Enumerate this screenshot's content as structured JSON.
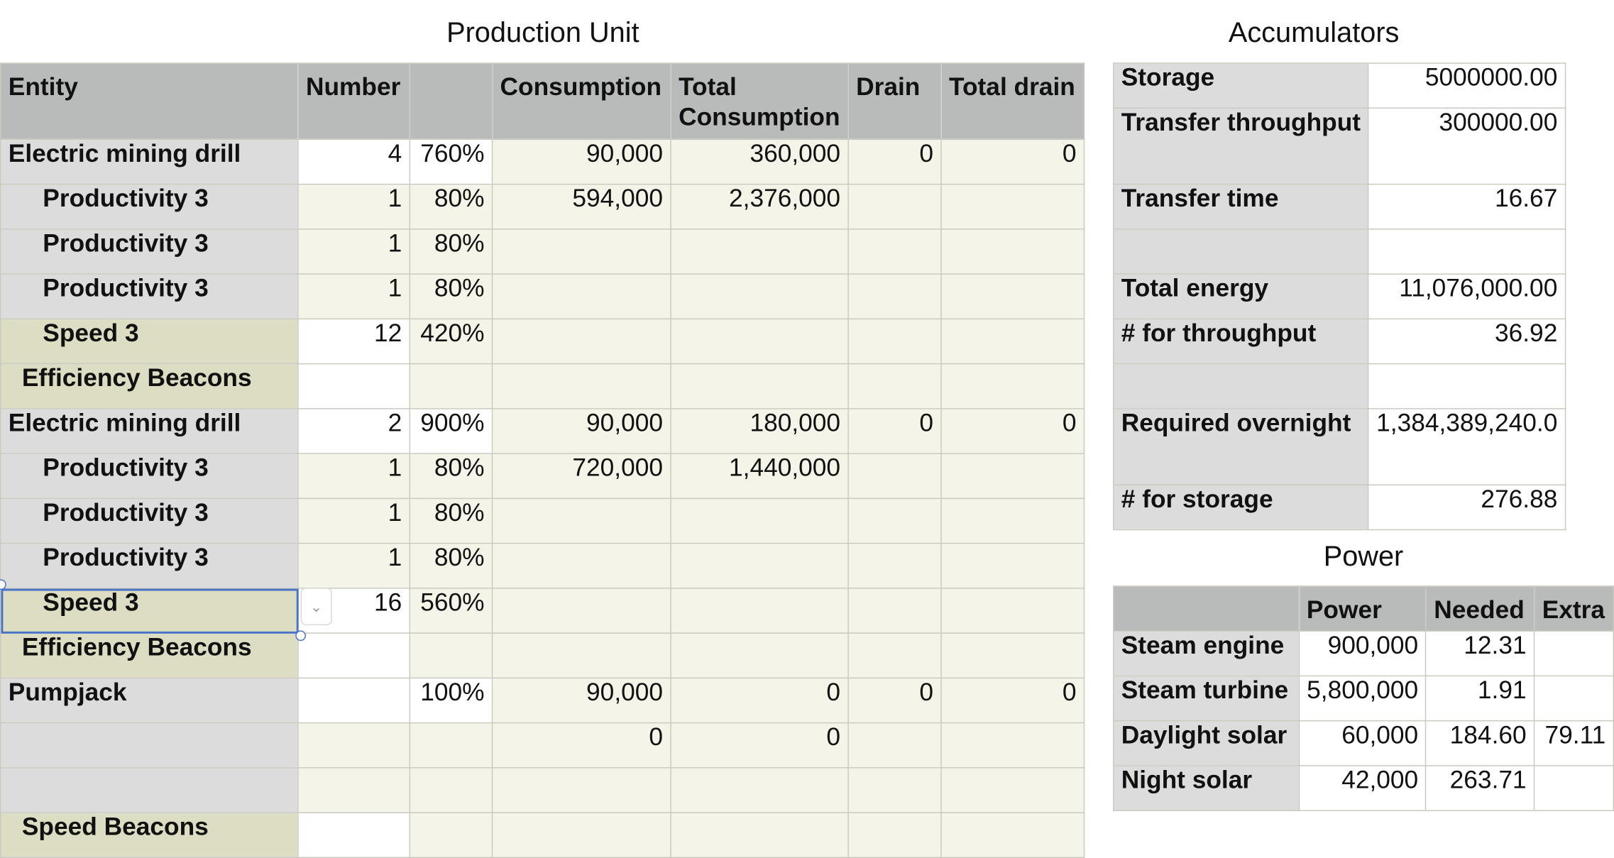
{
  "production": {
    "title": "Production Unit",
    "headers": {
      "entity": "Entity",
      "number": "Number",
      "pct": "",
      "consumption": "Consumption",
      "total_consumption": "Total Consumption",
      "drain": "Drain",
      "total_drain": "Total drain"
    },
    "rows": [
      {
        "entity": "Electric mining drill",
        "number": "4",
        "pct": "760%",
        "consumption": "90,000",
        "total_consumption": "360,000",
        "drain": "0",
        "total_drain": "0"
      },
      {
        "entity": "Productivity 3",
        "number": "1",
        "pct": "80%",
        "consumption": "594,000",
        "total_consumption": "2,376,000",
        "drain": "",
        "total_drain": ""
      },
      {
        "entity": "Productivity 3",
        "number": "1",
        "pct": "80%",
        "consumption": "",
        "total_consumption": "",
        "drain": "",
        "total_drain": ""
      },
      {
        "entity": "Productivity 3",
        "number": "1",
        "pct": "80%",
        "consumption": "",
        "total_consumption": "",
        "drain": "",
        "total_drain": ""
      },
      {
        "entity": "Speed 3",
        "number": "12",
        "pct": "420%",
        "consumption": "",
        "total_consumption": "",
        "drain": "",
        "total_drain": ""
      },
      {
        "entity": "Efficiency Beacons",
        "number": "",
        "pct": "",
        "consumption": "",
        "total_consumption": "",
        "drain": "",
        "total_drain": ""
      },
      {
        "entity": "Electric mining drill",
        "number": "2",
        "pct": "900%",
        "consumption": "90,000",
        "total_consumption": "180,000",
        "drain": "0",
        "total_drain": "0"
      },
      {
        "entity": "Productivity 3",
        "number": "1",
        "pct": "80%",
        "consumption": "720,000",
        "total_consumption": "1,440,000",
        "drain": "",
        "total_drain": ""
      },
      {
        "entity": "Productivity 3",
        "number": "1",
        "pct": "80%",
        "consumption": "",
        "total_consumption": "",
        "drain": "",
        "total_drain": ""
      },
      {
        "entity": "Productivity 3",
        "number": "1",
        "pct": "80%",
        "consumption": "",
        "total_consumption": "",
        "drain": "",
        "total_drain": ""
      },
      {
        "entity": "Speed 3",
        "number": "16",
        "pct": "560%",
        "consumption": "",
        "total_consumption": "",
        "drain": "",
        "total_drain": ""
      },
      {
        "entity": "Efficiency Beacons",
        "number": "",
        "pct": "",
        "consumption": "",
        "total_consumption": "",
        "drain": "",
        "total_drain": ""
      },
      {
        "entity": "Pumpjack",
        "number": "",
        "pct": "100%",
        "consumption": "90,000",
        "total_consumption": "0",
        "drain": "0",
        "total_drain": "0"
      },
      {
        "entity": "",
        "number": "",
        "pct": "",
        "consumption": "0",
        "total_consumption": "0",
        "drain": "",
        "total_drain": ""
      },
      {
        "entity": "",
        "number": "",
        "pct": "",
        "consumption": "",
        "total_consumption": "",
        "drain": "",
        "total_drain": ""
      },
      {
        "entity": "Speed Beacons",
        "number": "",
        "pct": "",
        "consumption": "",
        "total_consumption": "",
        "drain": "",
        "total_drain": ""
      }
    ]
  },
  "accumulators": {
    "title": "Accumulators",
    "rows": [
      {
        "label": "Storage",
        "value": "5000000.00"
      },
      {
        "label": "Transfer throughput",
        "value": "300000.00"
      },
      {
        "label": "Transfer time",
        "value": "16.67"
      },
      {
        "label": "",
        "value": ""
      },
      {
        "label": "Total energy",
        "value": "11,076,000.00"
      },
      {
        "label": "# for throughput",
        "value": "36.92"
      },
      {
        "label": "",
        "value": ""
      },
      {
        "label": "Required overnight",
        "value": "1,384,389,240.0"
      },
      {
        "label": "# for storage",
        "value": "276.88"
      }
    ]
  },
  "power": {
    "title": "Power",
    "headers": {
      "label": "",
      "power": "Power",
      "needed": "Needed",
      "extra": "Extra"
    },
    "rows": [
      {
        "label": "Steam engine",
        "power": "900,000",
        "needed": "12.31",
        "extra": ""
      },
      {
        "label": "Steam turbine",
        "power": "5,800,000",
        "needed": "1.91",
        "extra": ""
      },
      {
        "label": "Daylight solar",
        "power": "60,000",
        "needed": "184.60",
        "extra": "79.11"
      },
      {
        "label": "Night solar",
        "power": "42,000",
        "needed": "263.71",
        "extra": ""
      }
    ]
  },
  "colors": {
    "header_gray": "#b9bbba",
    "label_gray": "#dcdcdc",
    "beacon_olive": "#dcddc2",
    "cell_cream": "#f5f4e8",
    "selection_blue": "#4a73c8"
  },
  "icons": {
    "cell_dropdown": "chevron-down-icon"
  }
}
